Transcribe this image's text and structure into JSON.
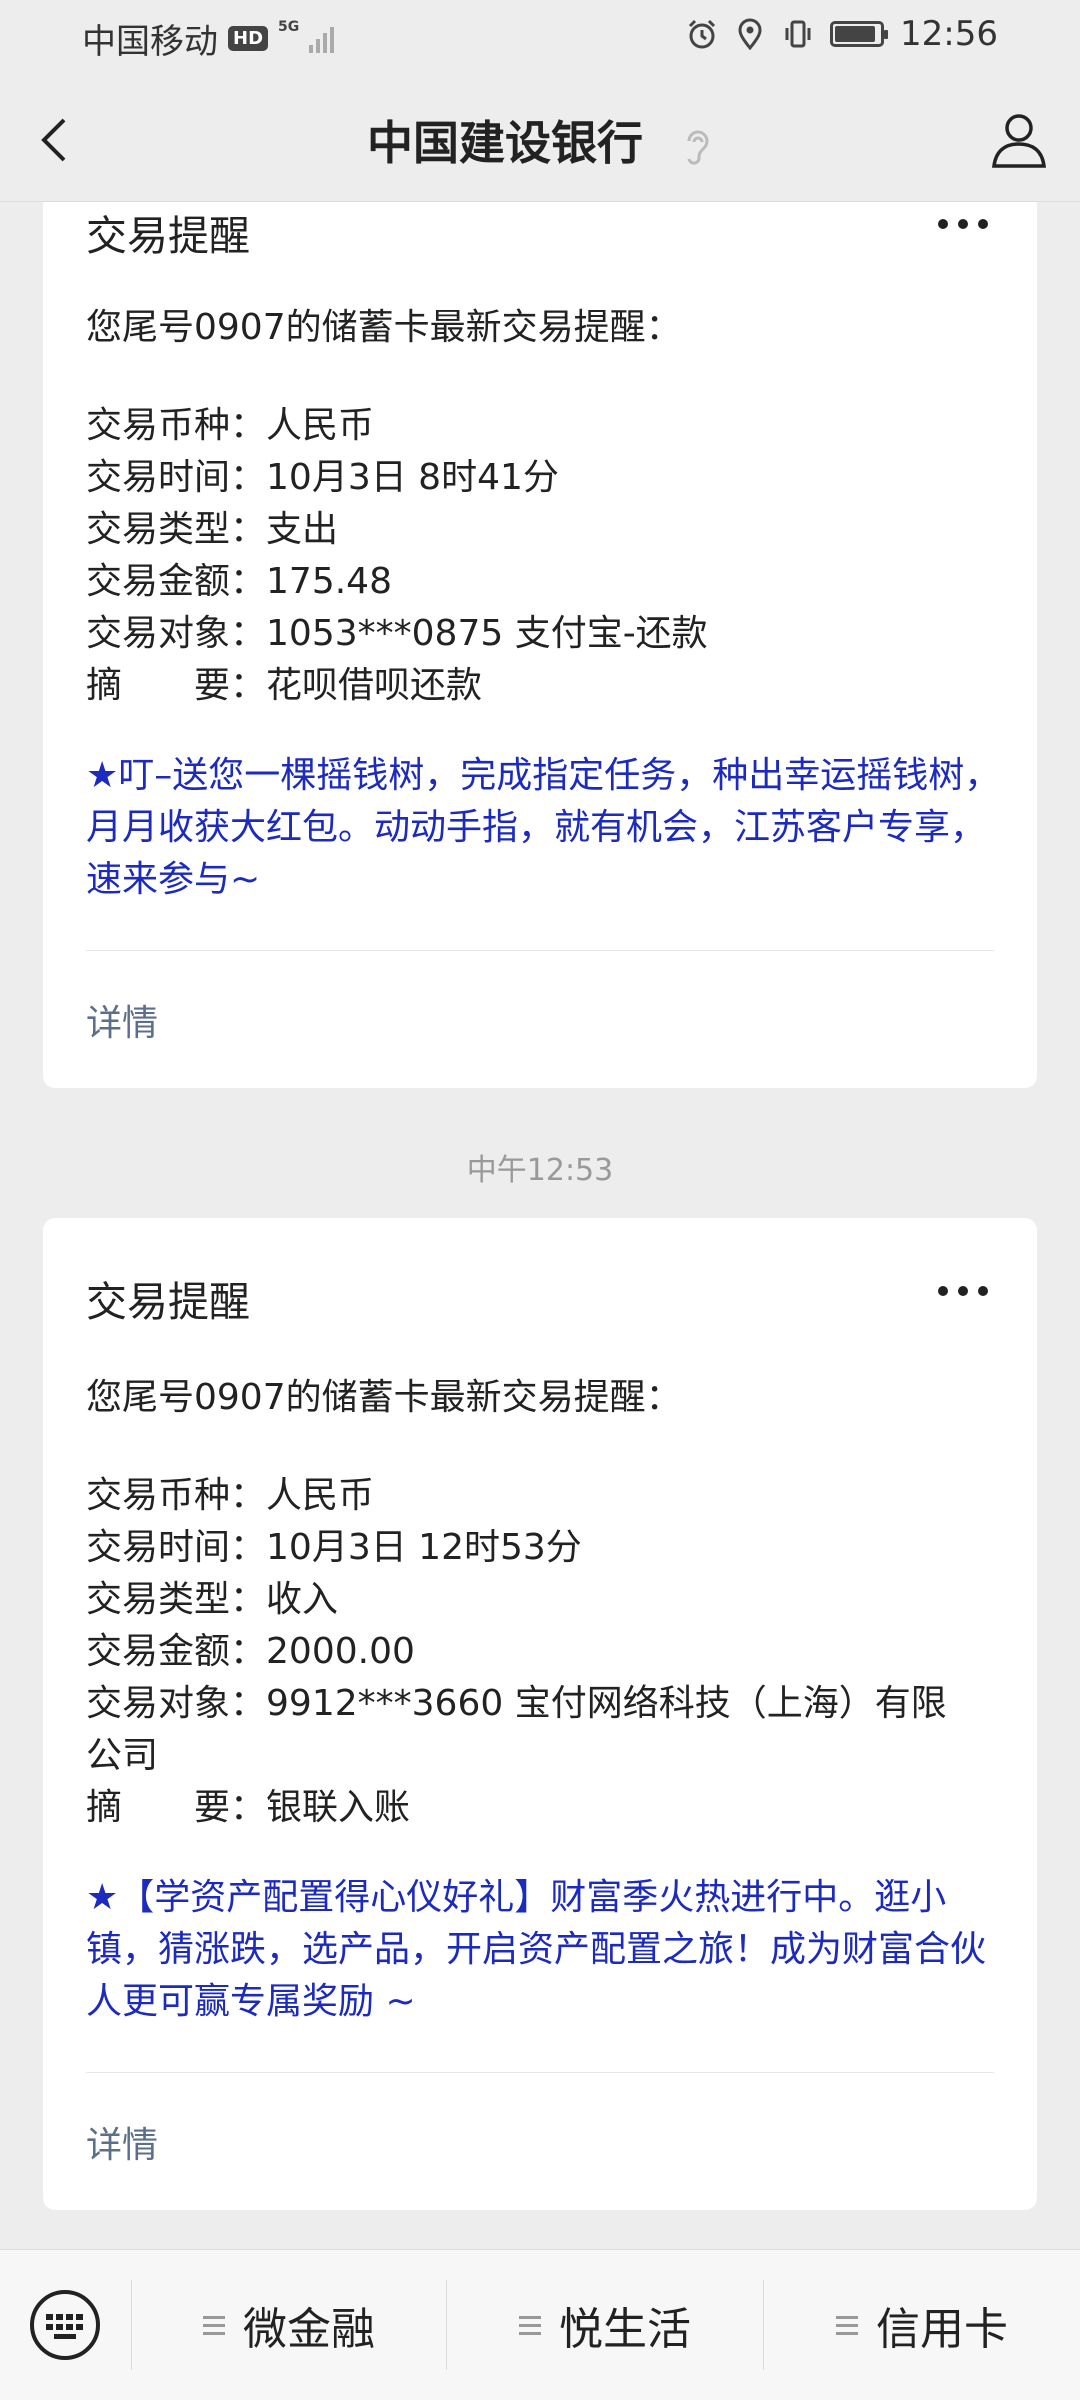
{
  "status_bar": {
    "carrier": "中国移动",
    "hd": "HD",
    "net": "5G",
    "time": "12:56"
  },
  "header": {
    "title": "中国建设银行"
  },
  "messages": [
    {
      "title": "交易提醒",
      "intro": "您尾号0907的储蓄卡最新交易提醒：",
      "fields": [
        {
          "label": "交易币种：",
          "value": "人民币"
        },
        {
          "label": "交易时间：",
          "value": "10月3日 8时41分"
        },
        {
          "label": "交易类型：",
          "value": "支出"
        },
        {
          "label": "交易金额：",
          "value": "175.48"
        },
        {
          "label": "交易对象：",
          "value": "1053***0875 支付宝-还款"
        },
        {
          "label": "摘　　要：",
          "value": "花呗借呗还款"
        }
      ],
      "promo": "★叮–送您一棵摇钱树，完成指定任务，种出幸运摇钱树，月月收获大红包。动动手指，就有机会，江苏客户专享，速来参与~",
      "detail": "详情"
    },
    {
      "title": "交易提醒",
      "intro": "您尾号0907的储蓄卡最新交易提醒：",
      "fields": [
        {
          "label": "交易币种：",
          "value": "人民币"
        },
        {
          "label": "交易时间：",
          "value": "10月3日 12时53分"
        },
        {
          "label": "交易类型：",
          "value": "收入"
        },
        {
          "label": "交易金额：",
          "value": "2000.00"
        },
        {
          "label": "交易对象：",
          "value": "9912***3660 宝付网络科技（上海）有限"
        },
        {
          "label": "",
          "value": "公司"
        },
        {
          "label": "摘　　要：",
          "value": "银联入账"
        }
      ],
      "promo": "★【学资产配置得心仪好礼】财富季火热进行中。逛小镇，猜涨跌，选产品，开启资产配置之旅！成为财富合伙人更可赢专属奖励 ~",
      "detail": "详情"
    }
  ],
  "timestamp": "中午12:53",
  "bottom_menu": [
    {
      "label": "微金融"
    },
    {
      "label": "悦生活"
    },
    {
      "label": "信用卡"
    }
  ]
}
